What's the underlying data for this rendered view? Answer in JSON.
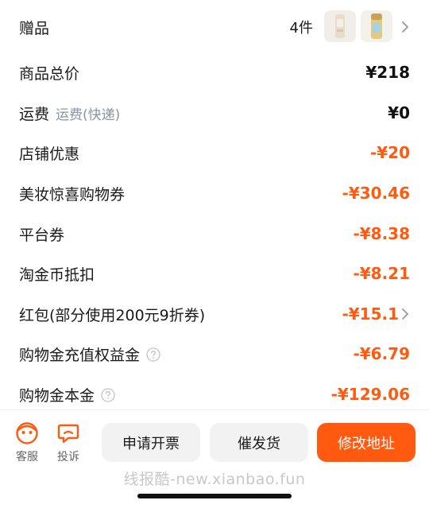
{
  "order_summary": {
    "gift": {
      "label": "赠品",
      "count": "4件"
    },
    "goods_total": {
      "label": "商品总价",
      "value": "¥218"
    },
    "shipping": {
      "label": "运费",
      "sub": "运费(快递)",
      "value": "¥0"
    },
    "store_discount": {
      "label": "店铺优惠",
      "value": "-¥20"
    },
    "beauty_coupon": {
      "label": "美妆惊喜购物券",
      "value": "-¥30.46"
    },
    "platform_coupon": {
      "label": "平台券",
      "value": "-¥8.38"
    },
    "taojinbi": {
      "label": "淘金币抵扣",
      "value": "-¥8.21"
    },
    "red_packet": {
      "label": "红包(部分使用200元9折券)",
      "value": "-¥15.1"
    },
    "recharge_bonus": {
      "label": "购物金充值权益金",
      "value": "-¥6.79"
    },
    "shopping_gold": {
      "label": "购物金本金",
      "value": "-¥129.06"
    }
  },
  "bottom_bar": {
    "customer_service": "客服",
    "complaint": "投诉",
    "invoice_button": "申请开票",
    "urge_ship_button": "催发货",
    "change_address_button": "修改地址"
  },
  "watermark": "线报酷-new.xianbao.fun",
  "colors": {
    "accent": "#ff5a0f",
    "sub_text": "#8a93a6"
  }
}
